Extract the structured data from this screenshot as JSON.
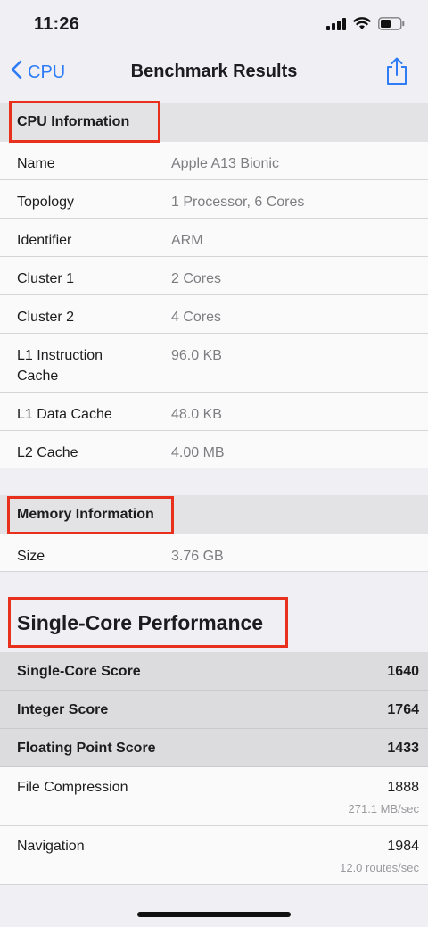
{
  "status": {
    "time": "11:26"
  },
  "nav": {
    "back_label": "CPU",
    "title": "Benchmark Results"
  },
  "cpu_info": {
    "header": "CPU Information",
    "rows": [
      {
        "label": "Name",
        "value": "Apple A13 Bionic"
      },
      {
        "label": "Topology",
        "value": "1 Processor, 6 Cores"
      },
      {
        "label": "Identifier",
        "value": "ARM"
      },
      {
        "label": "Cluster 1",
        "value": "2 Cores"
      },
      {
        "label": "Cluster 2",
        "value": "4 Cores"
      },
      {
        "label_line1": "L1 Instruction",
        "label_line2": "Cache",
        "value": "96.0 KB"
      },
      {
        "label": "L1 Data Cache",
        "value": "48.0 KB"
      },
      {
        "label": "L2 Cache",
        "value": "4.00 MB"
      }
    ]
  },
  "memory_info": {
    "header": "Memory Information",
    "rows": [
      {
        "label": "Size",
        "value": "3.76 GB"
      }
    ]
  },
  "single_core": {
    "header": "Single-Core Performance",
    "scores": [
      {
        "label": "Single-Core Score",
        "value": "1640"
      },
      {
        "label": "Integer Score",
        "value": "1764"
      },
      {
        "label": "Floating Point Score",
        "value": "1433"
      }
    ],
    "benchmarks": [
      {
        "label": "File Compression",
        "score": "1888",
        "rate": "271.1 MB/sec"
      },
      {
        "label": "Navigation",
        "score": "1984",
        "rate": "12.0 routes/sec"
      }
    ]
  },
  "colors": {
    "accent": "#2f7cf6",
    "highlight_box": "#e8301c"
  }
}
